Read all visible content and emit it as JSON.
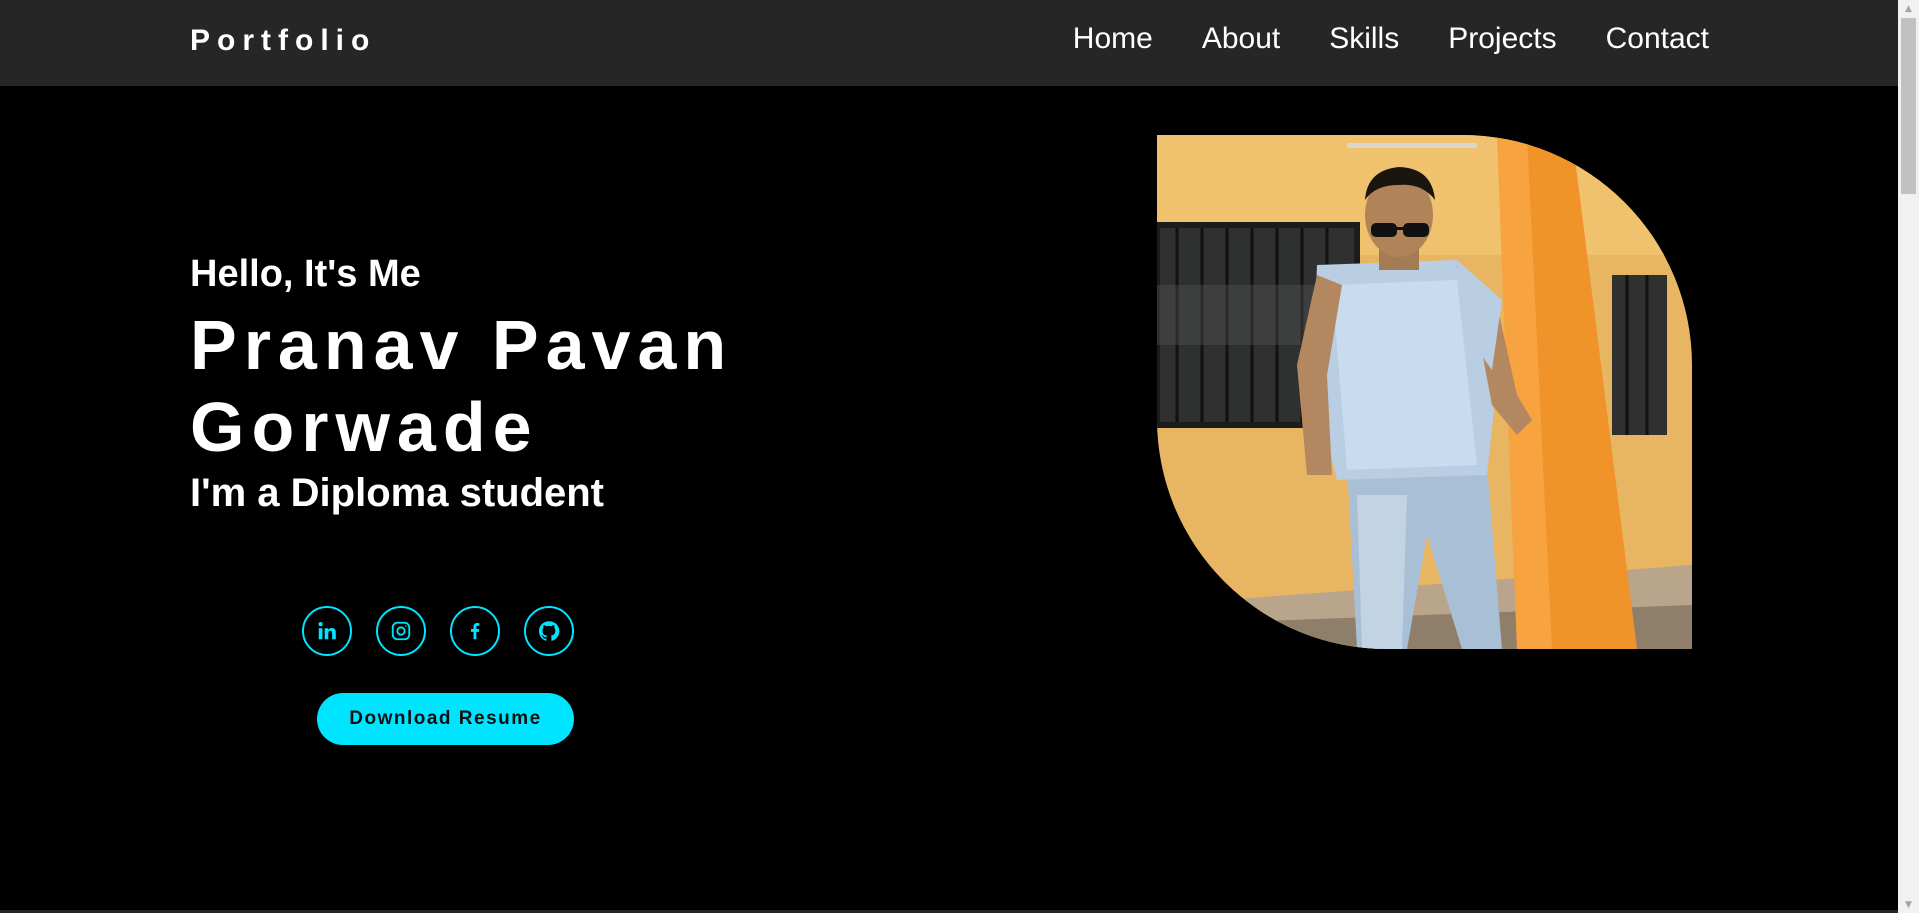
{
  "nav": {
    "brand": "Portfolio",
    "links": [
      "Home",
      "About",
      "Skills",
      "Projects",
      "Contact"
    ]
  },
  "hero": {
    "greeting": "Hello, It's Me",
    "name": "Pranav Pavan Gorwade",
    "role": "I'm a Diploma student",
    "resume_label": "Download Resume"
  },
  "socials": [
    "linkedin-icon",
    "instagram-icon",
    "facebook-icon",
    "github-icon"
  ],
  "colors": {
    "accent": "#00e5ff",
    "nav_bg": "#262626",
    "page_bg": "#000000"
  }
}
